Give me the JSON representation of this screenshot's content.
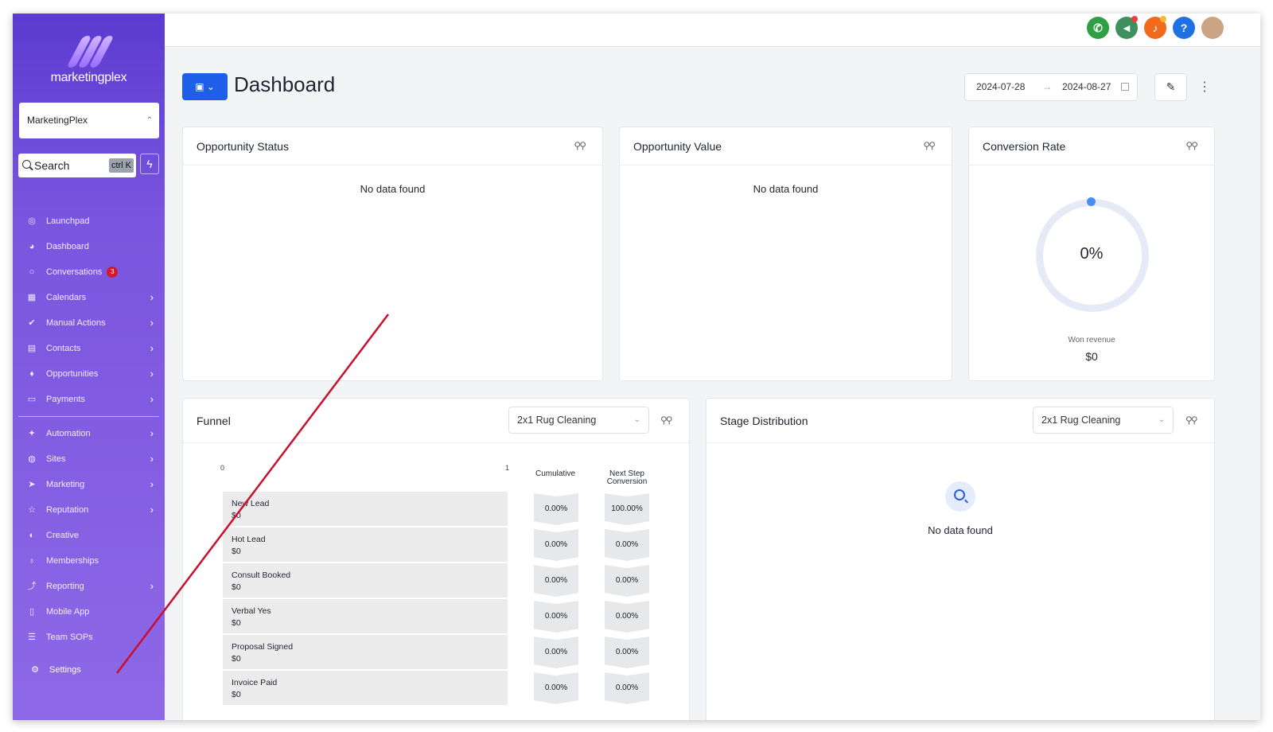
{
  "brand": {
    "name": "marketingplex"
  },
  "account": {
    "name": "MarketingPlex"
  },
  "search": {
    "label": "Search",
    "shortcut": "ctrl K"
  },
  "sidebar": {
    "items": [
      {
        "label": "Launchpad",
        "icon": "rocket-icon",
        "chevron": false
      },
      {
        "label": "Dashboard",
        "icon": "gauge-icon",
        "chevron": false
      },
      {
        "label": "Conversations",
        "icon": "chat-icon",
        "chevron": false,
        "badge": "3"
      },
      {
        "label": "Calendars",
        "icon": "calendar-icon",
        "chevron": true
      },
      {
        "label": "Manual Actions",
        "icon": "check-circle-icon",
        "chevron": true
      },
      {
        "label": "Contacts",
        "icon": "contacts-icon",
        "chevron": true
      },
      {
        "label": "Opportunities",
        "icon": "flame-icon",
        "chevron": true
      },
      {
        "label": "Payments",
        "icon": "card-icon",
        "chevron": true
      }
    ],
    "items2": [
      {
        "label": "Automation",
        "icon": "magic-wand-icon",
        "chevron": true
      },
      {
        "label": "Sites",
        "icon": "globe-icon",
        "chevron": true
      },
      {
        "label": "Marketing",
        "icon": "send-icon",
        "chevron": true
      },
      {
        "label": "Reputation",
        "icon": "star-icon",
        "chevron": true
      },
      {
        "label": "Creative",
        "icon": "palette-icon",
        "chevron": false
      },
      {
        "label": "Memberships",
        "icon": "award-icon",
        "chevron": false
      },
      {
        "label": "Reporting",
        "icon": "chart-icon",
        "chevron": true
      },
      {
        "label": "Mobile App",
        "icon": "phone-icon",
        "chevron": false
      },
      {
        "label": "Team SOPs",
        "icon": "list-icon",
        "chevron": false
      }
    ],
    "settings": "Settings"
  },
  "header": {
    "title": "Dashboard",
    "date_from": "2024-07-28",
    "date_to": "2024-08-27"
  },
  "cards": {
    "opportunity_status": {
      "title": "Opportunity Status",
      "empty": "No data found"
    },
    "opportunity_value": {
      "title": "Opportunity Value",
      "empty": "No data found"
    },
    "conversion_rate": {
      "title": "Conversion Rate",
      "value": "0%",
      "won_label": "Won revenue",
      "won_value": "$0"
    },
    "funnel": {
      "title": "Funnel",
      "pipeline": "2x1 Rug Cleaning",
      "axis_min": "0",
      "axis_max": "1",
      "col_cumulative": "Cumulative",
      "col_next_line1": "Next Step",
      "col_next_line2": "Conversion",
      "stages": [
        {
          "name": "New Lead",
          "value": "$0",
          "cumulative": "0.00%",
          "next": "100.00%"
        },
        {
          "name": "Hot Lead",
          "value": "$0",
          "cumulative": "0.00%",
          "next": "0.00%"
        },
        {
          "name": "Consult Booked",
          "value": "$0",
          "cumulative": "0.00%",
          "next": "0.00%"
        },
        {
          "name": "Verbal Yes",
          "value": "$0",
          "cumulative": "0.00%",
          "next": "0.00%"
        },
        {
          "name": "Proposal Signed",
          "value": "$0",
          "cumulative": "0.00%",
          "next": "0.00%"
        },
        {
          "name": "Invoice Paid",
          "value": "$0",
          "cumulative": "0.00%",
          "next": "0.00%"
        }
      ]
    },
    "stage_distribution": {
      "title": "Stage Distribution",
      "pipeline": "2x1 Rug Cleaning",
      "empty": "No data found"
    }
  },
  "colors": {
    "accent": "#1f5ee8",
    "sidebar_top": "#5b3bd0",
    "sidebar_bottom": "#8d68e6",
    "annotation": "#c8102e"
  }
}
